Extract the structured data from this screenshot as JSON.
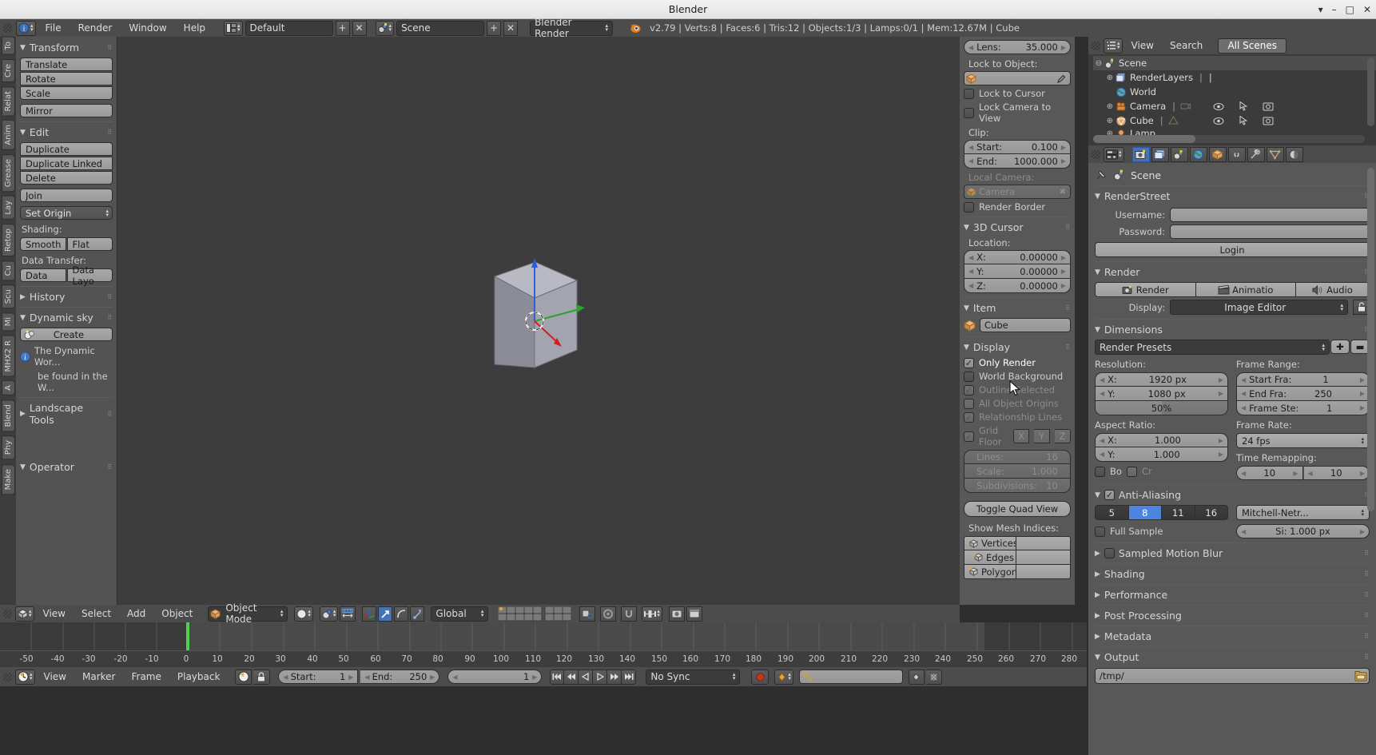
{
  "window": {
    "title": "Blender",
    "minimize": "–",
    "maximize": "□",
    "close": "✕",
    "dropdown": "▾"
  },
  "topbar": {
    "menus": [
      "File",
      "Render",
      "Window",
      "Help"
    ],
    "screen_layout": "Default",
    "add_label": "+",
    "remove_label": "✕",
    "scene_name": "Scene",
    "engine": "Blender Render",
    "status": "v2.79 | Verts:8 | Faces:6 | Tris:12 | Objects:1/3 | Lamps:0/1 | Mem:12.67M | Cube"
  },
  "tool_tabs": [
    "To",
    "Cre",
    "Relat",
    "Anim",
    "Grease",
    "Lay",
    "Retop",
    "Cu",
    "Scu",
    "Mi",
    "MHX2 R",
    "A",
    "Blend",
    "Phy",
    "Make"
  ],
  "toolshelf": {
    "transform": {
      "title": "Transform",
      "buttons": [
        "Translate",
        "Rotate",
        "Scale",
        "Mirror"
      ]
    },
    "edit": {
      "title": "Edit",
      "buttons": [
        "Duplicate",
        "Duplicate Linked",
        "Delete",
        "Join"
      ],
      "set_origin": "Set Origin",
      "shading_label": "Shading:",
      "shading": [
        "Smooth",
        "Flat"
      ],
      "data_transfer_label": "Data Transfer:",
      "data_transfer": [
        "Data",
        "Data Layo"
      ]
    },
    "history": {
      "title": "History"
    },
    "dynamic_sky": {
      "title": "Dynamic sky",
      "create": "Create",
      "info_line1": "The Dynamic Wor...",
      "info_line2": "be found in the W..."
    },
    "landscape": {
      "title": "Landscape Tools"
    },
    "operator": {
      "title": "Operator"
    }
  },
  "npanel": {
    "lens_label": "Lens:",
    "lens_value": "35.000",
    "lock_to_object_label": "Lock to Object:",
    "lock_to_object_value": "",
    "lock_to_cursor": "Lock to Cursor",
    "lock_camera_to_view": "Lock Camera to View",
    "clip_label": "Clip:",
    "clip_start_label": "Start:",
    "clip_start_value": "0.100",
    "clip_end_label": "End:",
    "clip_end_value": "1000.000",
    "local_camera_label": "Local Camera:",
    "local_camera_value": "Camera",
    "render_border": "Render Border",
    "cursor": {
      "title": "3D Cursor",
      "location_label": "Location:",
      "axes": [
        {
          "label": "X:",
          "value": "0.00000"
        },
        {
          "label": "Y:",
          "value": "0.00000"
        },
        {
          "label": "Z:",
          "value": "0.00000"
        }
      ]
    },
    "item": {
      "title": "Item",
      "name": "Cube"
    },
    "display": {
      "title": "Display",
      "only_render": "Only Render",
      "world_background": "World Background",
      "outline_selected": "Outline Selected",
      "all_object_origins": "All Object Origins",
      "relationship_lines": "Relationship Lines",
      "grid_floor": "Grid Floor",
      "axes": [
        "X",
        "Y",
        "Z"
      ],
      "lines_label": "Lines:",
      "lines_value": "16",
      "scale_label": "Scale:",
      "scale_value": "1.000",
      "subdivisions_label": "Subdivisions:",
      "subdivisions_value": "10",
      "toggle_quad_view": "Toggle Quad View",
      "mesh_indices_label": "Show Mesh Indices:",
      "mesh_indices": [
        "Vertices",
        "Edges",
        "Polygons"
      ]
    }
  },
  "viewport_header": {
    "menus": [
      "View",
      "Select",
      "Add",
      "Object"
    ],
    "mode": "Object Mode",
    "transform_orientation": "Global"
  },
  "timeline": {
    "menus": [
      "View",
      "Marker",
      "Frame",
      "Playback"
    ],
    "start_label": "Start:",
    "start_value": "1",
    "end_label": "End:",
    "end_value": "250",
    "current_frame": "1",
    "sync": "No Sync",
    "ticks": [
      "-50",
      "-40",
      "-30",
      "-20",
      "-10",
      "0",
      "10",
      "20",
      "30",
      "40",
      "50",
      "60",
      "70",
      "80",
      "90",
      "100",
      "110",
      "120",
      "130",
      "140",
      "150",
      "160",
      "170",
      "180",
      "190",
      "200",
      "210",
      "220",
      "230",
      "240",
      "250",
      "260",
      "270",
      "280"
    ],
    "playhead_frame": "1"
  },
  "outliner": {
    "menus": [
      "View",
      "Search"
    ],
    "filter": "All Scenes",
    "rows": [
      {
        "label": "Scene",
        "icon": "scene-icon",
        "indent": 0,
        "expander": "⊖"
      },
      {
        "label": "RenderLayers",
        "icon": "renderlayers-icon",
        "indent": 1,
        "expander": "⊕"
      },
      {
        "label": "World",
        "icon": "world-icon",
        "indent": 1,
        "expander": ""
      },
      {
        "label": "Camera",
        "icon": "camera-icon",
        "indent": 1,
        "expander": "⊕"
      },
      {
        "label": "Cube",
        "icon": "mesh-icon",
        "indent": 1,
        "expander": "⊕"
      },
      {
        "label": "Lamp",
        "icon": "lamp-icon",
        "indent": 1,
        "expander": "⊕"
      }
    ]
  },
  "properties": {
    "breadcrumb": "Scene",
    "renderstreet": {
      "title": "RenderStreet",
      "username_label": "Username:",
      "username_value": "",
      "password_label": "Password:",
      "password_value": "",
      "login": "Login"
    },
    "render": {
      "title": "Render",
      "render_btn": "Render",
      "animation_btn": "Animatio",
      "audio_btn": "Audio",
      "display_label": "Display:",
      "display_value": "Image Editor"
    },
    "dimensions": {
      "title": "Dimensions",
      "presets": "Render Presets",
      "resolution_label": "Resolution:",
      "res_x_label": "X:",
      "res_x_value": "1920 px",
      "res_y_label": "Y:",
      "res_y_value": "1080 px",
      "res_percent": "50%",
      "frame_range_label": "Frame Range:",
      "start_label": "Start Fra:",
      "start_value": "1",
      "end_label": "End Fra:",
      "end_value": "250",
      "step_label": "Frame Ste:",
      "step_value": "1",
      "aspect_label": "Aspect Ratio:",
      "aspect_x_label": "X:",
      "aspect_x_value": "1.000",
      "aspect_y_label": "Y:",
      "aspect_y_value": "1.000",
      "border_label": "Bo",
      "crop_label": "Cr",
      "frame_rate_label": "Frame Rate:",
      "frame_rate_value": "24 fps",
      "time_remapping_label": "Time Remapping:",
      "remap_old": "10",
      "remap_new": "10"
    },
    "anti_aliasing": {
      "title": "Anti-Aliasing",
      "samples": [
        "5",
        "8",
        "11",
        "16"
      ],
      "active_sample": "8",
      "filter": "Mitchell-Netr...",
      "full_sample": "Full Sample",
      "size_label": "Si: 1.000 px"
    },
    "collapsed": [
      "Sampled Motion Blur",
      "Shading",
      "Performance",
      "Post Processing",
      "Metadata"
    ],
    "output": {
      "title": "Output",
      "path": "/tmp/"
    }
  },
  "colors": {
    "accent_blue": "#4772b3",
    "header_gray": "#4c4c4c",
    "panel_gray": "#585858",
    "viewport_gray": "#3d3d3d",
    "field_light": "#9b9b9b",
    "playhead_green": "#4dd24d",
    "cube_face_light": "#b3b3bd",
    "cube_face_mid": "#9a9aa6",
    "cube_face_dark": "#7e7e8c"
  }
}
